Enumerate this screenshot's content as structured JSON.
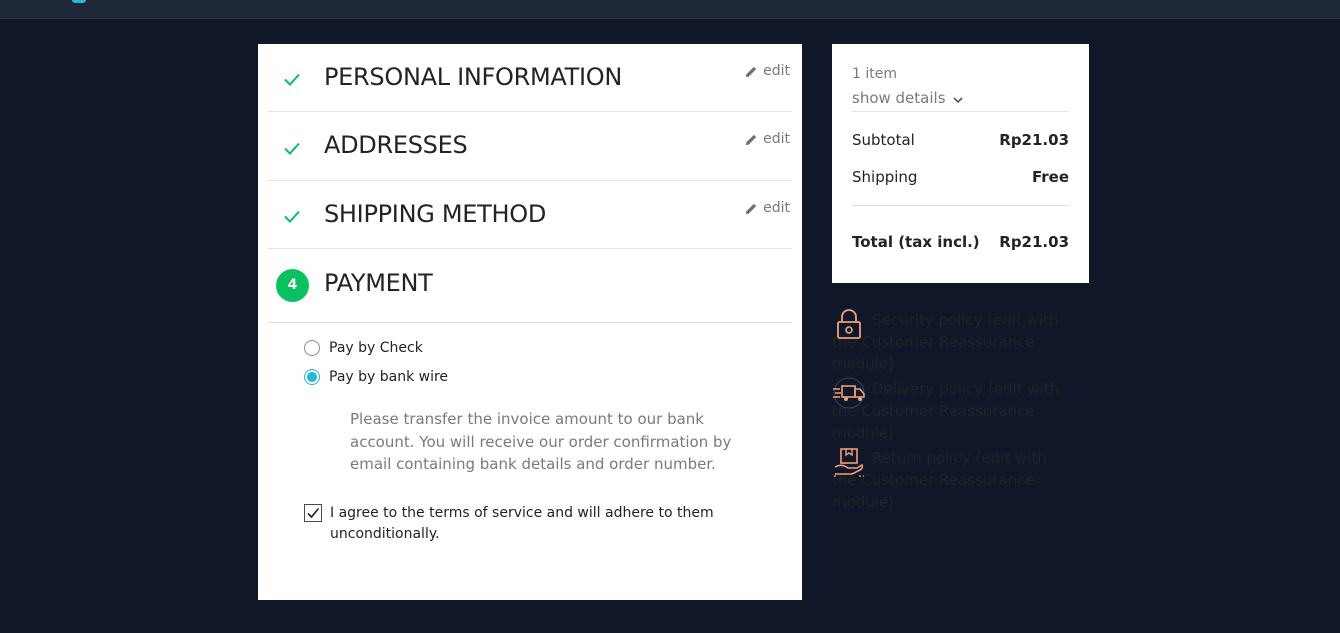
{
  "checkout": {
    "steps": [
      {
        "title": "PERSONAL INFORMATION",
        "edit_label": "edit"
      },
      {
        "title": "ADDRESSES",
        "edit_label": "edit"
      },
      {
        "title": "SHIPPING METHOD",
        "edit_label": "edit"
      }
    ],
    "payment": {
      "step_number": "4",
      "title": "PAYMENT",
      "options": [
        {
          "label": "Pay by Check",
          "selected": false
        },
        {
          "label": "Pay by bank wire",
          "selected": true
        }
      ],
      "bank_wire_info": "Please transfer the invoice amount to our bank account. You will receive our order confirmation by email containing bank details and order number.",
      "terms_label": "I agree to the terms of service and will adhere to them unconditionally.",
      "terms_checked": true
    }
  },
  "summary": {
    "items_count": "1 item",
    "show_details": "show details",
    "subtotal_label": "Subtotal",
    "subtotal_value": "Rp21.03",
    "shipping_label": "Shipping",
    "shipping_value": "Free",
    "total_label": "Total (tax incl.)",
    "total_value": "Rp21.03"
  },
  "reassurance": [
    {
      "title": "Security policy",
      "text": "Security policy (edit with the Customer Reassurance module)",
      "icon": "lock-icon"
    },
    {
      "title": "Delivery policy",
      "text": "Delivery policy (edit with the Customer Reassurance module)",
      "icon": "delivery-truck-icon"
    },
    {
      "title": "Return policy",
      "text": "Return policy (edit with the Customer Reassurance module)",
      "icon": "return-package-icon"
    }
  ],
  "colors": {
    "page_background": "#0f1729",
    "accent_green": "#0ac060",
    "accent_blue": "#24b9d7",
    "reassurance_icon": "#f0a07a"
  }
}
